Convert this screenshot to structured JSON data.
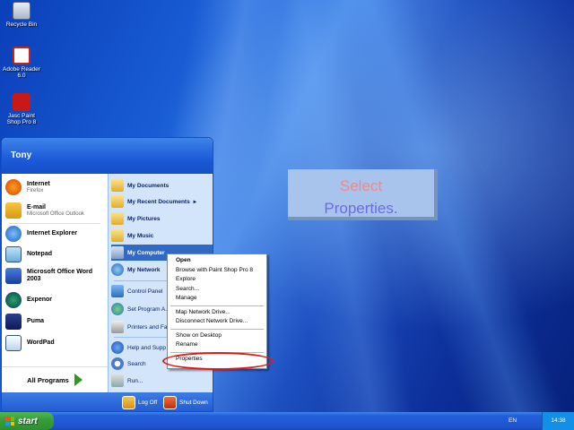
{
  "desktop": {
    "icons": [
      {
        "label": "Recycle Bin",
        "icon": "recycle-bin-icon"
      },
      {
        "label": "Adobe Reader 6.0",
        "icon": "adobe-reader-icon"
      },
      {
        "label": "Jasc Paint Shop Pro 8",
        "icon": "paint-shop-pro-icon"
      }
    ]
  },
  "callout": {
    "line1": "Select",
    "line2": "Properties."
  },
  "start_menu": {
    "user": "Tony",
    "pinned": [
      {
        "title": "Internet",
        "subtitle": "Firefox",
        "icon": "firefox-icon"
      },
      {
        "title": "E-mail",
        "subtitle": "Microsoft Office Outlook",
        "icon": "outlook-icon"
      }
    ],
    "recent": [
      {
        "title": "Internet Explorer",
        "icon": "ie-icon"
      },
      {
        "title": "Notepad",
        "icon": "notepad-icon"
      },
      {
        "title": "Microsoft Office Word 2003",
        "icon": "word-icon"
      },
      {
        "title": "Expenor",
        "icon": "expenor-icon"
      },
      {
        "title": "Puma",
        "icon": "puma-icon"
      },
      {
        "title": "WordPad",
        "icon": "wordpad-icon"
      }
    ],
    "all_programs": "All Programs",
    "right": [
      {
        "label": "My Documents",
        "icon": "folder-icon"
      },
      {
        "label": "My Recent Documents",
        "icon": "folder-icon",
        "submenu": "▸"
      },
      {
        "label": "My Pictures",
        "icon": "folder-icon"
      },
      {
        "label": "My Music",
        "icon": "folder-icon"
      },
      {
        "label": "My Computer",
        "icon": "computer-icon"
      },
      {
        "label": "My Network",
        "icon": "network-icon"
      }
    ],
    "right_lower": [
      {
        "label": "Control Panel",
        "icon": "control-panel-icon"
      },
      {
        "label": "Set Program A... Defaults",
        "icon": "defaults-icon"
      },
      {
        "label": "Printers and Fa",
        "icon": "printer-icon"
      }
    ],
    "right_bottom": [
      {
        "label": "Help and Supp",
        "icon": "help-icon"
      },
      {
        "label": "Search",
        "icon": "search-icon"
      },
      {
        "label": "Run...",
        "icon": "run-icon"
      }
    ],
    "footer": {
      "logoff": "Log Off",
      "shutdown": "Shut Down"
    }
  },
  "context_menu": {
    "group1": [
      "Open",
      "Browse with Paint Shop Pro 8",
      "Explore",
      "Search...",
      "Manage"
    ],
    "group2": [
      "Map Network Drive...",
      "Disconnect Network Drive..."
    ],
    "group3": [
      "Show on Desktop",
      "Rename"
    ],
    "group4": [
      "Properties"
    ]
  },
  "taskbar": {
    "start_label": "start",
    "language": "EN",
    "clock": "14:38"
  },
  "colors": {
    "highlight": "#316ac5",
    "annotation_ellipse": "#e01818"
  }
}
